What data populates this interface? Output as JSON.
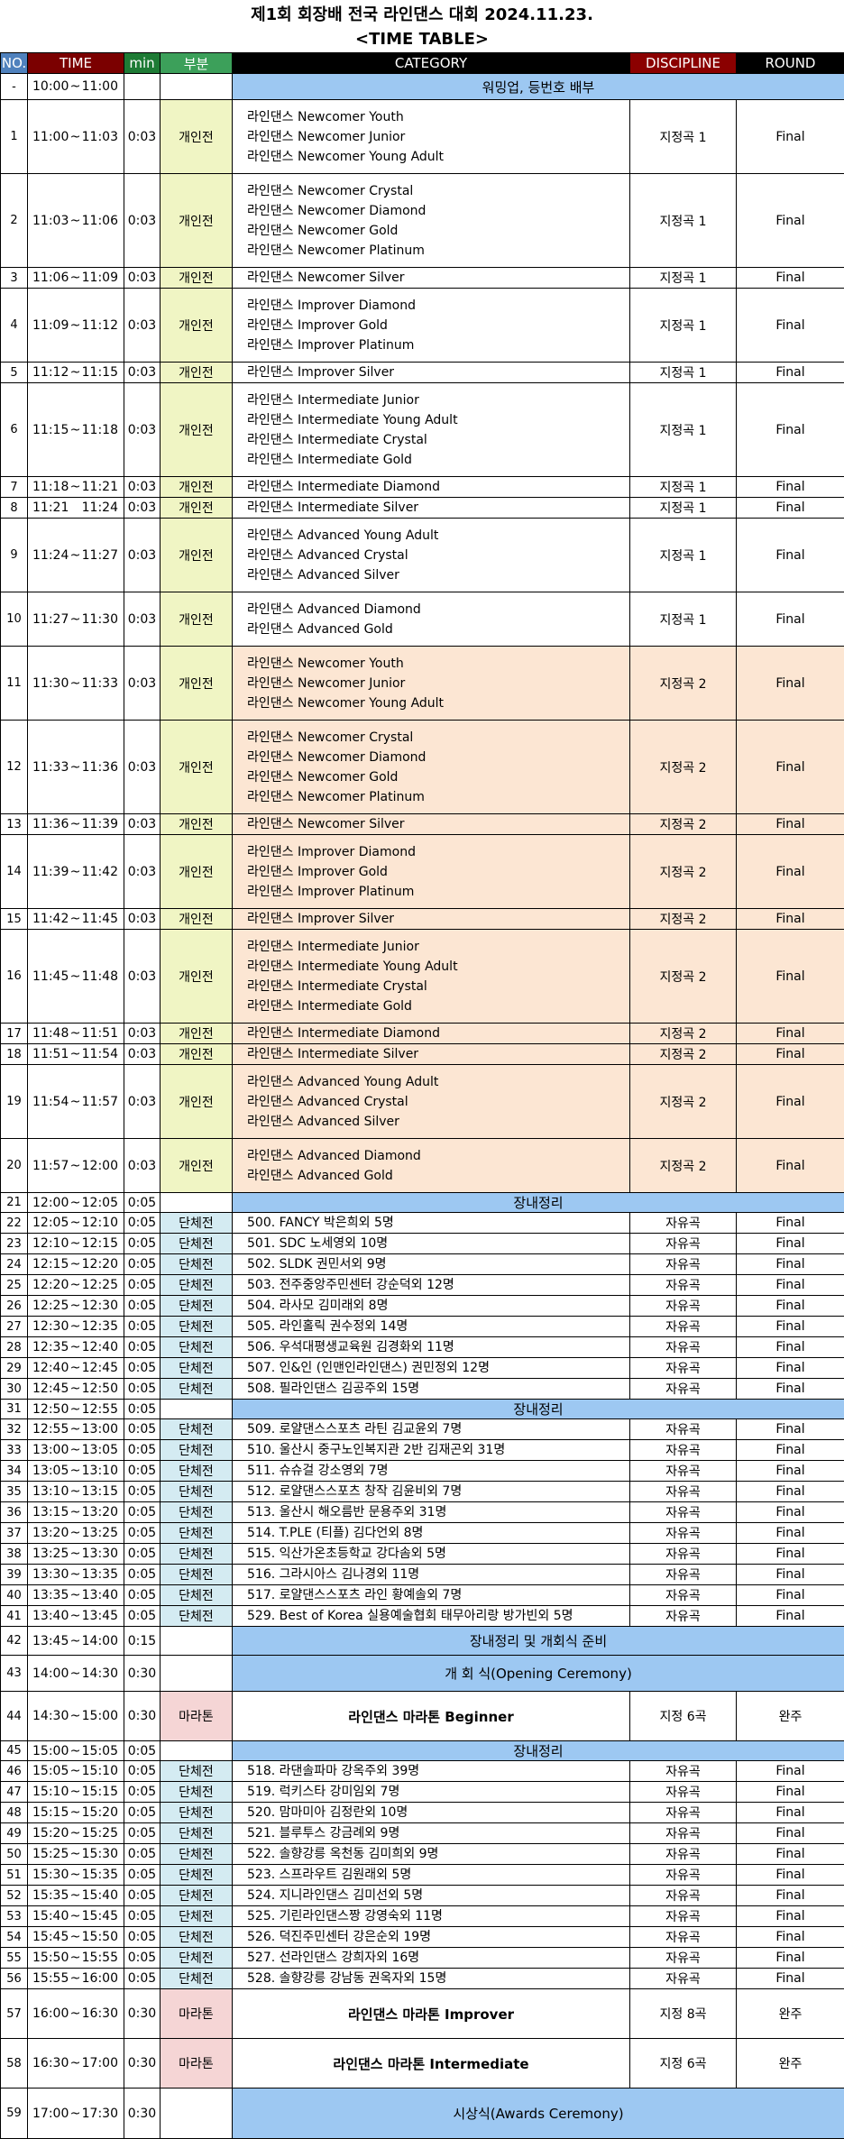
{
  "title_line1": "제1회 회장배 전국 라인댄스 대회 2024.11.23.",
  "title_line2": "<TIME TABLE>",
  "headers": {
    "no": "NO.",
    "time": "TIME",
    "min": "min",
    "bu": "부분",
    "category": "CATEGORY",
    "discipline": "DISCIPLINE",
    "round": "ROUND"
  },
  "rows": [
    {
      "no": "-",
      "start": "10:00",
      "sep": "~",
      "end": "11:00",
      "min": "",
      "bu": "",
      "band": "워밍업, 등번호 배부",
      "h": 29
    },
    {
      "no": "1",
      "start": "11:00",
      "sep": "~",
      "end": "11:03",
      "min": "0:03",
      "bu": "개인전",
      "cat": [
        "라인댄스  Newcomer Youth",
        "라인댄스  Newcomer Junior",
        "라인댄스  Newcomer Young Adult"
      ],
      "disc": "지정곡 1",
      "round": "Final"
    },
    {
      "no": "2",
      "start": "11:03",
      "sep": "~",
      "end": "11:06",
      "min": "0:03",
      "bu": "개인전",
      "cat": [
        "라인댄스  Newcomer Crystal",
        "라인댄스  Newcomer Diamond",
        "라인댄스  Newcomer Gold",
        "라인댄스  Newcomer Platinum"
      ],
      "disc": "지정곡 1",
      "round": "Final"
    },
    {
      "no": "3",
      "start": "11:06",
      "sep": "~",
      "end": "11:09",
      "min": "0:03",
      "bu": "개인전",
      "cat": [
        "라인댄스  Newcomer Silver"
      ],
      "disc": "지정곡 1",
      "round": "Final"
    },
    {
      "no": "4",
      "start": "11:09",
      "sep": "~",
      "end": "11:12",
      "min": "0:03",
      "bu": "개인전",
      "cat": [
        "라인댄스  Improver Diamond",
        "라인댄스  Improver Gold",
        "라인댄스  Improver Platinum"
      ],
      "disc": "지정곡 1",
      "round": "Final"
    },
    {
      "no": "5",
      "start": "11:12",
      "sep": "~",
      "end": "11:15",
      "min": "0:03",
      "bu": "개인전",
      "cat": [
        "라인댄스  Improver Silver"
      ],
      "disc": "지정곡 1",
      "round": "Final"
    },
    {
      "no": "6",
      "start": "11:15",
      "sep": "~",
      "end": "11:18",
      "min": "0:03",
      "bu": "개인전",
      "cat": [
        "라인댄스  Intermediate Junior",
        "라인댄스  Intermediate Young Adult",
        "라인댄스  Intermediate Crystal",
        "라인댄스  Intermediate Gold"
      ],
      "disc": "지정곡 1",
      "round": "Final"
    },
    {
      "no": "7",
      "start": "11:18",
      "sep": "~",
      "end": "11:21",
      "min": "0:03",
      "bu": "개인전",
      "cat": [
        "라인댄스  Intermediate Diamond"
      ],
      "disc": "지정곡 1",
      "round": "Final"
    },
    {
      "no": "8",
      "start": "11:21",
      "sep": "",
      "end": "11:24",
      "min": "0:03",
      "bu": "개인전",
      "cat": [
        "라인댄스  Intermediate Silver"
      ],
      "disc": "지정곡 1",
      "round": "Final"
    },
    {
      "no": "9",
      "start": "11:24",
      "sep": "~",
      "end": "11:27",
      "min": "0:03",
      "bu": "개인전",
      "cat": [
        "라인댄스  Advanced Young Adult",
        "라인댄스  Advanced Crystal",
        "라인댄스  Advanced Silver"
      ],
      "disc": "지정곡 1",
      "round": "Final"
    },
    {
      "no": "10",
      "start": "11:27",
      "sep": "~",
      "end": "11:30",
      "min": "0:03",
      "bu": "개인전",
      "cat": [
        "라인댄스  Advanced Diamond",
        "라인댄스  Advanced Gold"
      ],
      "disc": "지정곡 1",
      "round": "Final"
    },
    {
      "no": "11",
      "start": "11:30",
      "sep": "~",
      "end": "11:33",
      "min": "0:03",
      "bu": "개인전",
      "cat": [
        "라인댄스  Newcomer Youth",
        "라인댄스  Newcomer Junior",
        "라인댄스  Newcomer Young Adult"
      ],
      "disc": "지정곡 2",
      "round": "Final",
      "peach": true
    },
    {
      "no": "12",
      "start": "11:33",
      "sep": "~",
      "end": "11:36",
      "min": "0:03",
      "bu": "개인전",
      "cat": [
        "라인댄스  Newcomer Crystal",
        "라인댄스  Newcomer Diamond",
        "라인댄스  Newcomer Gold",
        "라인댄스  Newcomer Platinum"
      ],
      "disc": "지정곡 2",
      "round": "Final",
      "peach": true
    },
    {
      "no": "13",
      "start": "11:36",
      "sep": "~",
      "end": "11:39",
      "min": "0:03",
      "bu": "개인전",
      "cat": [
        "라인댄스  Newcomer Silver"
      ],
      "disc": "지정곡 2",
      "round": "Final",
      "peach": true
    },
    {
      "no": "14",
      "start": "11:39",
      "sep": "~",
      "end": "11:42",
      "min": "0:03",
      "bu": "개인전",
      "cat": [
        "라인댄스  Improver Diamond",
        "라인댄스  Improver Gold",
        "라인댄스  Improver Platinum"
      ],
      "disc": "지정곡 2",
      "round": "Final",
      "peach": true
    },
    {
      "no": "15",
      "start": "11:42",
      "sep": "~",
      "end": "11:45",
      "min": "0:03",
      "bu": "개인전",
      "cat": [
        "라인댄스  Improver Silver"
      ],
      "disc": "지정곡 2",
      "round": "Final",
      "peach": true
    },
    {
      "no": "16",
      "start": "11:45",
      "sep": "~",
      "end": "11:48",
      "min": "0:03",
      "bu": "개인전",
      "cat": [
        "라인댄스  Intermediate Junior",
        "라인댄스  Intermediate Young Adult",
        "라인댄스  Intermediate Crystal",
        "라인댄스  Intermediate Gold"
      ],
      "disc": "지정곡 2",
      "round": "Final",
      "peach": true
    },
    {
      "no": "17",
      "start": "11:48",
      "sep": "~",
      "end": "11:51",
      "min": "0:03",
      "bu": "개인전",
      "cat": [
        "라인댄스  Intermediate Diamond"
      ],
      "disc": "지정곡 2",
      "round": "Final",
      "peach": true
    },
    {
      "no": "18",
      "start": "11:51",
      "sep": "~",
      "end": "11:54",
      "min": "0:03",
      "bu": "개인전",
      "cat": [
        "라인댄스  Intermediate Silver"
      ],
      "disc": "지정곡 2",
      "round": "Final",
      "peach": true
    },
    {
      "no": "19",
      "start": "11:54",
      "sep": "~",
      "end": "11:57",
      "min": "0:03",
      "bu": "개인전",
      "cat": [
        "라인댄스  Advanced Young Adult",
        "라인댄스  Advanced Crystal",
        "라인댄스  Advanced Silver"
      ],
      "disc": "지정곡 2",
      "round": "Final",
      "peach": true
    },
    {
      "no": "20",
      "start": "11:57",
      "sep": "~",
      "end": "12:00",
      "min": "0:03",
      "bu": "개인전",
      "cat": [
        "라인댄스  Advanced Diamond",
        "라인댄스  Advanced Gold"
      ],
      "disc": "지정곡 2",
      "round": "Final",
      "peach": true
    },
    {
      "no": "21",
      "start": "12:00",
      "sep": "~",
      "end": "12:05",
      "min": "0:05",
      "bu": "",
      "band": "장내정리",
      "h": 21
    },
    {
      "no": "22",
      "start": "12:05",
      "sep": "~",
      "end": "12:10",
      "min": "0:05",
      "bu": "단체전",
      "cat": [
        "500. FANCY 박은희외 5명"
      ],
      "disc": "자유곡",
      "round": "Final"
    },
    {
      "no": "23",
      "start": "12:10",
      "sep": "~",
      "end": "12:15",
      "min": "0:05",
      "bu": "단체전",
      "cat": [
        "501. SDC 노세영외 10명"
      ],
      "disc": "자유곡",
      "round": "Final"
    },
    {
      "no": "24",
      "start": "12:15",
      "sep": "~",
      "end": "12:20",
      "min": "0:05",
      "bu": "단체전",
      "cat": [
        "502. SLDK 권민서외 9명"
      ],
      "disc": "자유곡",
      "round": "Final"
    },
    {
      "no": "25",
      "start": "12:20",
      "sep": "~",
      "end": "12:25",
      "min": "0:05",
      "bu": "단체전",
      "cat": [
        "503. 전주중앙주민센터 강순덕외 12명"
      ],
      "disc": "자유곡",
      "round": "Final"
    },
    {
      "no": "26",
      "start": "12:25",
      "sep": "~",
      "end": "12:30",
      "min": "0:05",
      "bu": "단체전",
      "cat": [
        "504. 라사모 김미래외 8명"
      ],
      "disc": "자유곡",
      "round": "Final"
    },
    {
      "no": "27",
      "start": "12:30",
      "sep": "~",
      "end": "12:35",
      "min": "0:05",
      "bu": "단체전",
      "cat": [
        "505. 라인홀릭 권수정외 14명"
      ],
      "disc": "자유곡",
      "round": "Final"
    },
    {
      "no": "28",
      "start": "12:35",
      "sep": "~",
      "end": "12:40",
      "min": "0:05",
      "bu": "단체전",
      "cat": [
        "506. 우석대평생교육원 김경화외 11명"
      ],
      "disc": "자유곡",
      "round": "Final"
    },
    {
      "no": "29",
      "start": "12:40",
      "sep": "~",
      "end": "12:45",
      "min": "0:05",
      "bu": "단체전",
      "cat": [
        "507. 인&인 (인맨인라인댄스) 권민정외 12명"
      ],
      "disc": "자유곡",
      "round": "Final"
    },
    {
      "no": "30",
      "start": "12:45",
      "sep": "~",
      "end": "12:50",
      "min": "0:05",
      "bu": "단체전",
      "cat": [
        "508. 필라인댄스 김공주외 15명"
      ],
      "disc": "자유곡",
      "round": "Final"
    },
    {
      "no": "31",
      "start": "12:50",
      "sep": "~",
      "end": "12:55",
      "min": "0:05",
      "bu": "",
      "band": "장내정리",
      "h": 21
    },
    {
      "no": "32",
      "start": "12:55",
      "sep": "~",
      "end": "13:00",
      "min": "0:05",
      "bu": "단체전",
      "cat": [
        "509. 로얄댄스스포츠 라틴 김교윤외 7명"
      ],
      "disc": "자유곡",
      "round": "Final"
    },
    {
      "no": "33",
      "start": "13:00",
      "sep": "~",
      "end": "13:05",
      "min": "0:05",
      "bu": "단체전",
      "cat": [
        "510. 울산시 중구노인복지관 2반 김재곤외 31명"
      ],
      "disc": "자유곡",
      "round": "Final"
    },
    {
      "no": "34",
      "start": "13:05",
      "sep": "~",
      "end": "13:10",
      "min": "0:05",
      "bu": "단체전",
      "cat": [
        "511. 슈슈걸 강소영외 7명"
      ],
      "disc": "자유곡",
      "round": "Final"
    },
    {
      "no": "35",
      "start": "13:10",
      "sep": "~",
      "end": "13:15",
      "min": "0:05",
      "bu": "단체전",
      "cat": [
        "512. 로얄댄스스포츠 창작 김윤비외 7명"
      ],
      "disc": "자유곡",
      "round": "Final"
    },
    {
      "no": "36",
      "start": "13:15",
      "sep": "~",
      "end": "13:20",
      "min": "0:05",
      "bu": "단체전",
      "cat": [
        "513. 울산시 해오름반 문용주외 31명"
      ],
      "disc": "자유곡",
      "round": "Final"
    },
    {
      "no": "37",
      "start": "13:20",
      "sep": "~",
      "end": "13:25",
      "min": "0:05",
      "bu": "단체전",
      "cat": [
        "514. T.PLE (티플) 김다언외 8명"
      ],
      "disc": "자유곡",
      "round": "Final"
    },
    {
      "no": "38",
      "start": "13:25",
      "sep": "~",
      "end": "13:30",
      "min": "0:05",
      "bu": "단체전",
      "cat": [
        "515. 익산가온초등학교 강다솜외 5명"
      ],
      "disc": "자유곡",
      "round": "Final"
    },
    {
      "no": "39",
      "start": "13:30",
      "sep": "~",
      "end": "13:35",
      "min": "0:05",
      "bu": "단체전",
      "cat": [
        "516. 그라시아스 김나경외 11명"
      ],
      "disc": "자유곡",
      "round": "Final"
    },
    {
      "no": "40",
      "start": "13:35",
      "sep": "~",
      "end": "13:40",
      "min": "0:05",
      "bu": "단체전",
      "cat": [
        "517. 로얄댄스스포츠 라인 황예솔외 7명"
      ],
      "disc": "자유곡",
      "round": "Final"
    },
    {
      "no": "41",
      "start": "13:40",
      "sep": "~",
      "end": "13:45",
      "min": "0:05",
      "bu": "단체전",
      "cat": [
        "529. Best of Korea 실용예술협회 태무아리랑 방가빈외 5명"
      ],
      "disc": "자유곡",
      "round": "Final"
    },
    {
      "no": "42",
      "start": "13:45",
      "sep": "~",
      "end": "14:00",
      "min": "0:15",
      "bu": "",
      "band": "장내정리 및 개회식 준비",
      "h": 32
    },
    {
      "no": "43",
      "start": "14:00",
      "sep": "~",
      "end": "14:30",
      "min": "0:30",
      "bu": "",
      "band": "개 회 식(Opening Ceremony)",
      "h": 40
    },
    {
      "no": "44",
      "start": "14:30",
      "sep": "~",
      "end": "15:00",
      "min": "0:30",
      "bu": "마라톤",
      "bold": "라인댄스 마라톤 Beginner",
      "disc": "지정 6곡",
      "round": "완주",
      "h": 55
    },
    {
      "no": "45",
      "start": "15:00",
      "sep": "~",
      "end": "15:05",
      "min": "0:05",
      "bu": "",
      "band": "장내정리",
      "h": 21
    },
    {
      "no": "46",
      "start": "15:05",
      "sep": "~",
      "end": "15:10",
      "min": "0:05",
      "bu": "단체전",
      "cat": [
        "518. 라댄솔파마 강옥주외 39명"
      ],
      "disc": "자유곡",
      "round": "Final"
    },
    {
      "no": "47",
      "start": "15:10",
      "sep": "~",
      "end": "15:15",
      "min": "0:05",
      "bu": "단체전",
      "cat": [
        "519. 럭키스타 강미임외 7명"
      ],
      "disc": "자유곡",
      "round": "Final"
    },
    {
      "no": "48",
      "start": "15:15",
      "sep": "~",
      "end": "15:20",
      "min": "0:05",
      "bu": "단체전",
      "cat": [
        "520. 맘마미아 김정란외 10명"
      ],
      "disc": "자유곡",
      "round": "Final"
    },
    {
      "no": "49",
      "start": "15:20",
      "sep": "~",
      "end": "15:25",
      "min": "0:05",
      "bu": "단체전",
      "cat": [
        "521. 블루투스 강금례외 9명"
      ],
      "disc": "자유곡",
      "round": "Final"
    },
    {
      "no": "50",
      "start": "15:25",
      "sep": "~",
      "end": "15:30",
      "min": "0:05",
      "bu": "단체전",
      "cat": [
        "522. 솔향강릉 옥천동 김미희외 9명"
      ],
      "disc": "자유곡",
      "round": "Final"
    },
    {
      "no": "51",
      "start": "15:30",
      "sep": "~",
      "end": "15:35",
      "min": "0:05",
      "bu": "단체전",
      "cat": [
        "523. 스프라우트 김원래외 5명"
      ],
      "disc": "자유곡",
      "round": "Final"
    },
    {
      "no": "52",
      "start": "15:35",
      "sep": "~",
      "end": "15:40",
      "min": "0:05",
      "bu": "단체전",
      "cat": [
        "524. 지니라인댄스 김미선외 5명"
      ],
      "disc": "자유곡",
      "round": "Final"
    },
    {
      "no": "53",
      "start": "15:40",
      "sep": "~",
      "end": "15:45",
      "min": "0:05",
      "bu": "단체전",
      "cat": [
        "525. 기린라인댄스짱 강영숙외 11명"
      ],
      "disc": "자유곡",
      "round": "Final"
    },
    {
      "no": "54",
      "start": "15:45",
      "sep": "~",
      "end": "15:50",
      "min": "0:05",
      "bu": "단체전",
      "cat": [
        "526. 덕진주민센터 강은순외 19명"
      ],
      "disc": "자유곡",
      "round": "Final"
    },
    {
      "no": "55",
      "start": "15:50",
      "sep": "~",
      "end": "15:55",
      "min": "0:05",
      "bu": "단체전",
      "cat": [
        "527. 선라인댄스 강희자외 16명"
      ],
      "disc": "자유곡",
      "round": "Final"
    },
    {
      "no": "56",
      "start": "15:55",
      "sep": "~",
      "end": "16:00",
      "min": "0:05",
      "bu": "단체전",
      "cat": [
        "528. 솔향강릉 강남동 권옥자외 15명"
      ],
      "disc": "자유곡",
      "round": "Final"
    },
    {
      "no": "57",
      "start": "16:00",
      "sep": "~",
      "end": "16:30",
      "min": "0:30",
      "bu": "마라톤",
      "bold": "라인댄스 마라톤 Improver",
      "disc": "지정 8곡",
      "round": "완주",
      "h": 55
    },
    {
      "no": "58",
      "start": "16:30",
      "sep": "~",
      "end": "17:00",
      "min": "0:30",
      "bu": "마라톤",
      "bold": "라인댄스 마라톤 Intermediate",
      "disc": "지정 6곡",
      "round": "완주",
      "h": 55
    },
    {
      "no": "59",
      "start": "17:00",
      "sep": "~",
      "end": "17:30",
      "min": "0:30",
      "bu": "",
      "band": "시상식(Awards Ceremony)",
      "h": 56
    }
  ]
}
